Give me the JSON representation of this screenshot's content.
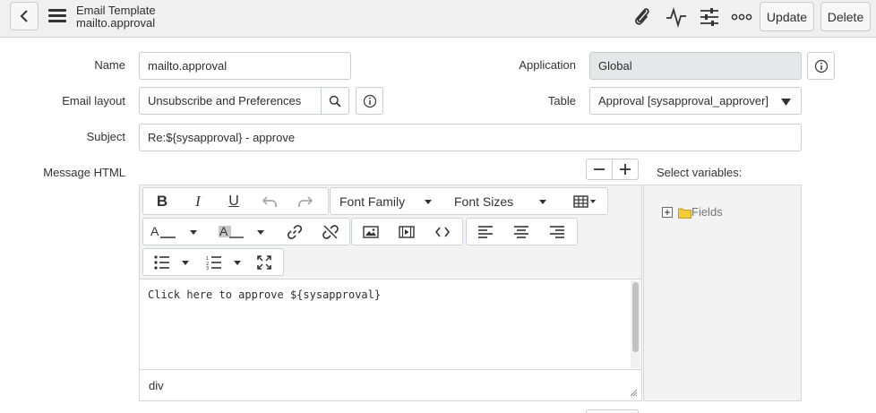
{
  "header": {
    "title": "Email Template",
    "subtitle": "mailto.approval",
    "update_label": "Update",
    "delete_label": "Delete"
  },
  "form": {
    "name": {
      "label": "Name",
      "value": "mailto.approval"
    },
    "application": {
      "label": "Application",
      "value": "Global"
    },
    "email_layout": {
      "label": "Email layout",
      "value": "Unsubscribe and Preferences"
    },
    "table": {
      "label": "Table",
      "value": "Approval [sysapproval_approver]"
    },
    "subject": {
      "label": "Subject",
      "value": "Re:${sysapproval} - approve"
    },
    "message_html": {
      "label": "Message HTML"
    }
  },
  "editor": {
    "font_family_label": "Font Family",
    "font_sizes_label": "Font Sizes",
    "content": "Click here to approve ${sysapproval}",
    "status_path": "div"
  },
  "variables": {
    "title": "Select variables:",
    "fields_label": "Fields"
  }
}
